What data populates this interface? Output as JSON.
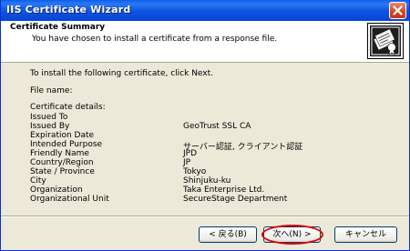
{
  "window": {
    "title": "IIS Certificate Wizard"
  },
  "header": {
    "title": "Certificate Summary",
    "subtitle": "You have chosen to install a certificate from a response file."
  },
  "content": {
    "intro": "To install the following certificate, click Next.",
    "file_name_label": "File name:",
    "details_label": "Certificate details:",
    "details": [
      {
        "key": "Issued To",
        "value": ""
      },
      {
        "key": "Issued By",
        "value": "GeoTrust SSL CA"
      },
      {
        "key": "Expiration Date",
        "value": ""
      },
      {
        "key": "Intended Purpose",
        "value": "サーバー認証, クライアント認証"
      },
      {
        "key": "Friendly Name",
        "value": "JPD"
      },
      {
        "key": "Country/Region",
        "value": "JP"
      },
      {
        "key": "State / Province",
        "value": "Tokyo"
      },
      {
        "key": "City",
        "value": "Shinjuku-ku"
      },
      {
        "key": "Organization",
        "value": "Taka Enterprise Ltd."
      },
      {
        "key": "Organizational Unit",
        "value": "SecureStage Department"
      }
    ]
  },
  "buttons": {
    "back": "< 戻る(B)",
    "next": "次へ(N) >",
    "cancel": "キャンセル"
  },
  "colors": {
    "titlebar": "#0A5FEF",
    "highlight": "#E00000",
    "face": "#ECE9D8"
  },
  "icons": {
    "close": "close-icon",
    "wizard": "certificate-wizard-icon"
  }
}
